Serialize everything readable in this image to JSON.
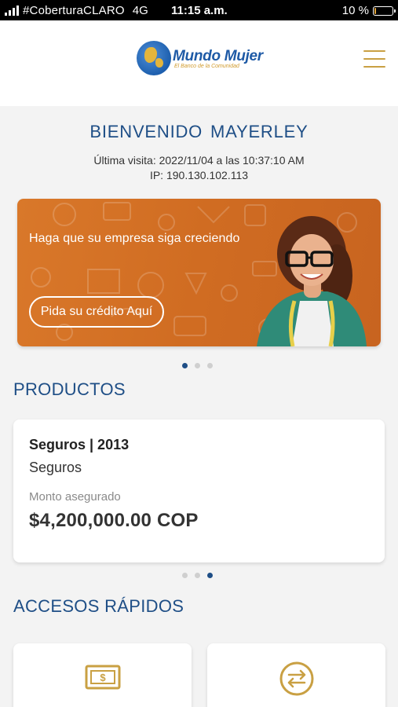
{
  "status_bar": {
    "carrier": "#CoberturaCLARO",
    "network": "4G",
    "time": "11:15 a.m.",
    "battery_label": "10 %",
    "battery_level": 0.1
  },
  "header": {
    "logo_title": "Mundo Mujer",
    "logo_subtitle": "El Banco de la Comunidad",
    "menu_icon": "hamburger-menu-icon"
  },
  "welcome": {
    "title": "BIENVENIDO  MAYERLEY",
    "last_visit": "Última visita: 2022/11/04 a las 10:37:10 AM",
    "ip": "IP: 190.130.102.113"
  },
  "banner": {
    "headline": "Haga que su empresa siga creciendo",
    "cta_label": "Pida su crédito Aquí",
    "slide_count": 3,
    "active_slide": 0
  },
  "products": {
    "section_title": "PRODUCTOS",
    "items": [
      {
        "name": "Seguros | 2013",
        "type": "Seguros",
        "label": "Monto asegurado",
        "amount": "$4,200,000.00 COP"
      }
    ],
    "slide_count": 3,
    "active_slide": 2
  },
  "quick_access": {
    "section_title": "ACCESOS RÁPIDOS",
    "items": [
      {
        "icon": "money-bill-icon"
      },
      {
        "icon": "transfer-arrows-icon"
      }
    ]
  },
  "colors": {
    "primary": "#1e4e86",
    "gold": "#c9a043",
    "banner_orange": "#d06c22"
  }
}
